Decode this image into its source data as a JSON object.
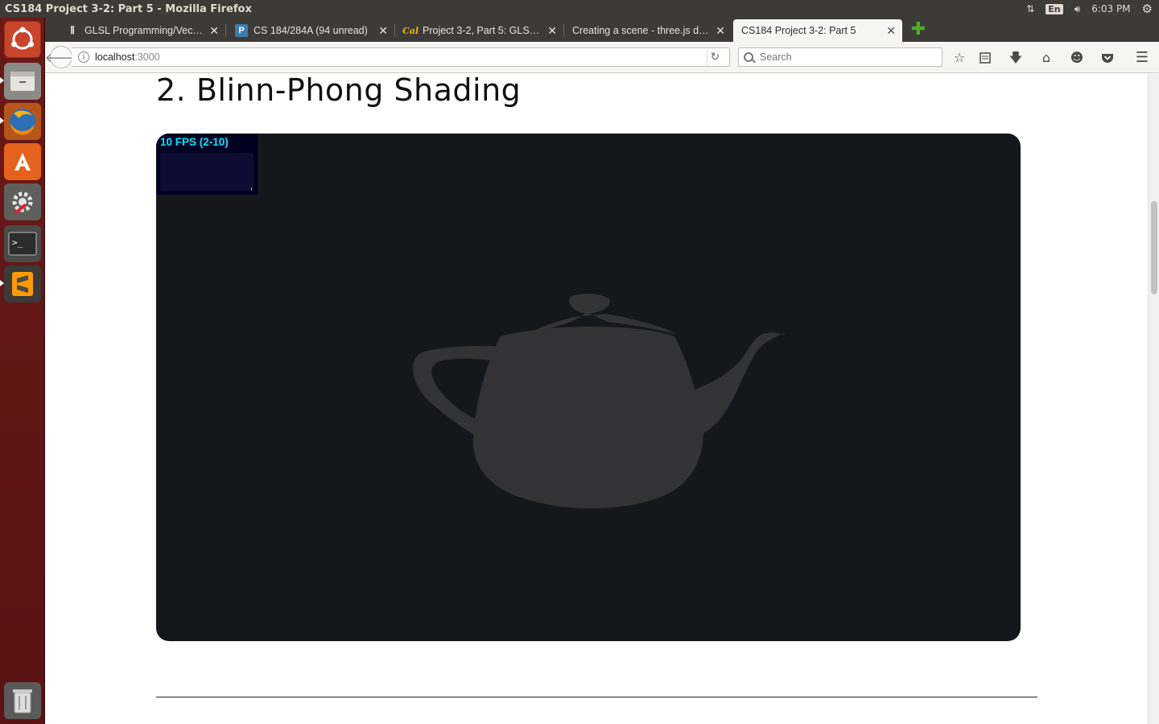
{
  "window": {
    "title": "CS184 Project 3-2: Part 5 - Mozilla Firefox"
  },
  "system": {
    "keyboard": "En",
    "clock": "6:03 PM"
  },
  "tabs": [
    {
      "label": "GLSL Programming/Vec…",
      "icon": "wikibooks-icon"
    },
    {
      "label": "CS 184/284A (94 unread)",
      "icon": "piazza-icon"
    },
    {
      "label": "Project 3-2, Part 5: GLS…",
      "icon": "cal-icon"
    },
    {
      "label": "Creating a scene - three.js d…",
      "icon": "blank-page-icon"
    },
    {
      "label": "CS184 Project 3-2: Part 5",
      "icon": "none"
    }
  ],
  "navbar": {
    "url_host": "localhost",
    "url_port": ":3000",
    "search_placeholder": "Search"
  },
  "page": {
    "heading": "2. Blinn-Phong Shading",
    "fps_text": "10 FPS (2-10)"
  },
  "colors": {
    "canvas_bg": "#15171b",
    "teapot": "#333335",
    "fps_text": "#00e4ff"
  }
}
